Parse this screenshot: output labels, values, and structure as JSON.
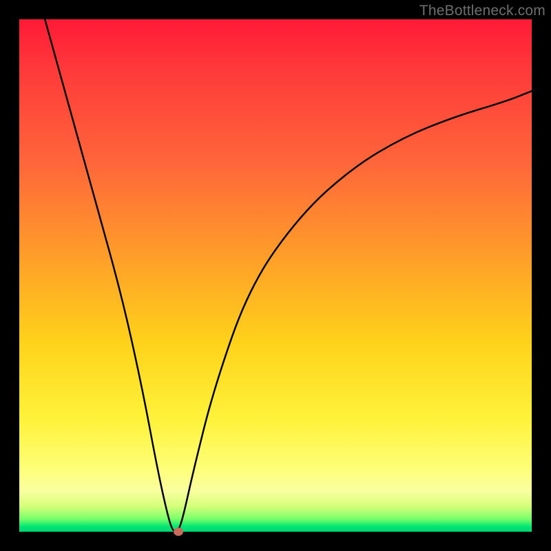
{
  "watermark": "TheBottleneck.com",
  "chart_data": {
    "type": "line",
    "title": "",
    "xlabel": "",
    "ylabel": "",
    "xlim": [
      0,
      100
    ],
    "ylim": [
      0,
      100
    ],
    "series": [
      {
        "name": "bottleneck-curve",
        "x": [
          5,
          10,
          15,
          20,
          24,
          27,
          29,
          30,
          31,
          32,
          34,
          38,
          45,
          55,
          65,
          75,
          85,
          95,
          100
        ],
        "values": [
          100,
          82,
          64,
          46,
          28,
          12,
          3,
          0,
          0,
          3,
          12,
          28,
          48,
          62,
          71,
          77,
          81,
          84,
          86
        ]
      }
    ],
    "marker": {
      "x": 31,
      "y": 0
    },
    "gradient_stops": [
      {
        "pos": 0,
        "color": "#ff1a36"
      },
      {
        "pos": 10,
        "color": "#ff3a3a"
      },
      {
        "pos": 28,
        "color": "#ff663a"
      },
      {
        "pos": 45,
        "color": "#ff9a2a"
      },
      {
        "pos": 63,
        "color": "#ffd21a"
      },
      {
        "pos": 78,
        "color": "#fff23a"
      },
      {
        "pos": 88,
        "color": "#feff7a"
      },
      {
        "pos": 92,
        "color": "#f9ffa0"
      },
      {
        "pos": 95,
        "color": "#d6ff7a"
      },
      {
        "pos": 97.5,
        "color": "#7aff6a"
      },
      {
        "pos": 99,
        "color": "#00e673"
      },
      {
        "pos": 100,
        "color": "#00d673"
      }
    ]
  }
}
